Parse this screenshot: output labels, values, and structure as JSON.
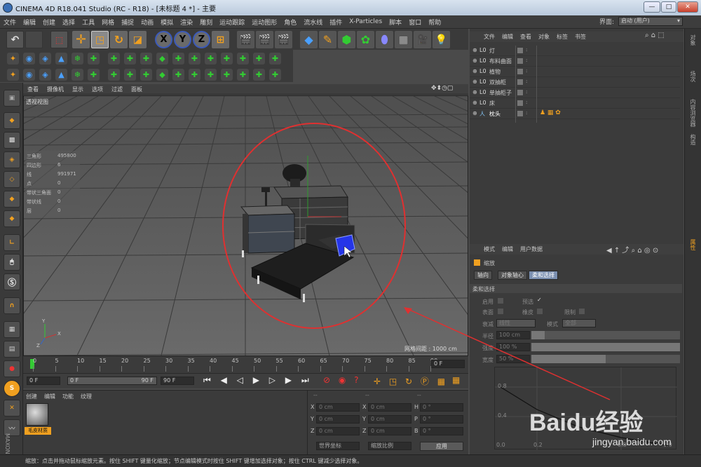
{
  "title": "CINEMA 4D R18.041 Studio (RC - R18) - [未标题 4 *] - 主要",
  "window_controls": {
    "minimize": "—",
    "maximize": "□",
    "close": "✕"
  },
  "menu": [
    "文件",
    "编辑",
    "创建",
    "选择",
    "工具",
    "网格",
    "捕捉",
    "动画",
    "模拟",
    "渲染",
    "雕刻",
    "运动跟踪",
    "运动图形",
    "角色",
    "流水线",
    "插件",
    "X-Particles",
    "脚本",
    "窗口",
    "帮助"
  ],
  "layout": {
    "label": "界面:",
    "value": "启动 (用户)"
  },
  "axis_buttons": {
    "x": "X",
    "y": "Y",
    "z": "Z"
  },
  "viewport": {
    "menu": [
      "查看",
      "摄像机",
      "显示",
      "选项",
      "过滤",
      "面板"
    ],
    "name": "透视视图",
    "grid_spacing": "网格间距 : 1000 cm",
    "stats": [
      {
        "label": "三角形",
        "value": "495800"
      },
      {
        "label": "四边形",
        "value": "6"
      },
      {
        "label": "线",
        "value": "991971"
      },
      {
        "label": "点",
        "value": "0"
      },
      {
        "label": "带状三角面",
        "value": "0"
      },
      {
        "label": "带状线",
        "value": "0"
      },
      {
        "label": "层",
        "value": "0"
      }
    ],
    "axis_labels": {
      "y": "Y",
      "x": "X",
      "z": "Z"
    }
  },
  "timeline": {
    "ticks": [
      "0",
      "5",
      "10",
      "15",
      "20",
      "25",
      "30",
      "35",
      "40",
      "45",
      "50",
      "55",
      "60",
      "65",
      "70",
      "75",
      "80",
      "85",
      "90"
    ],
    "current_frame": "0 F",
    "start": "0 F",
    "range_start": "0 F",
    "range_end": "90 F",
    "end": "90 F"
  },
  "material_panel": {
    "menu": [
      "创建",
      "编辑",
      "功能",
      "纹理"
    ],
    "material_name": "毛皮材质"
  },
  "coords": {
    "dashes": [
      "--",
      "--",
      "--"
    ],
    "rows": [
      {
        "a": "X",
        "av": "0 cm",
        "b": "X",
        "bv": "0 cm",
        "c": "H",
        "cv": "0 °"
      },
      {
        "a": "Y",
        "av": "0 cm",
        "b": "Y",
        "bv": "0 cm",
        "c": "P",
        "cv": "0 °"
      },
      {
        "a": "Z",
        "av": "0 cm",
        "b": "Z",
        "bv": "0 cm",
        "c": "B",
        "cv": "0 °"
      }
    ],
    "mode1": "世界坐标",
    "mode2": "缩放比例",
    "apply": "应用"
  },
  "object_manager": {
    "menu": [
      "文件",
      "编辑",
      "查看",
      "对象",
      "标签",
      "书签"
    ],
    "items": [
      {
        "name": "灯",
        "icon": "L0"
      },
      {
        "name": "布料曲面",
        "icon": "L0"
      },
      {
        "name": "植物",
        "icon": "L0"
      },
      {
        "name": "双抽柜",
        "icon": "L0"
      },
      {
        "name": "单抽柜子",
        "icon": "L0"
      },
      {
        "name": "床",
        "icon": "L0"
      },
      {
        "name": "枕头",
        "icon": "人"
      }
    ]
  },
  "attributes": {
    "menu": [
      "模式",
      "编辑",
      "用户数据"
    ],
    "object_name": "缩放",
    "tabs": [
      "轴向",
      "对象轴心",
      "柔和选择"
    ],
    "section": "柔和选择",
    "enable": "启用",
    "preview": "预选",
    "surface": "表面",
    "rubber": "橡皮",
    "limit": "限制",
    "mode_label": "衰减",
    "mode_value": "线性",
    "mode2_label": "模式",
    "mode2_value": "全部",
    "radius_label": "半径",
    "radius_value": "100 cm",
    "strength_label": "强度",
    "strength_value": "100 %",
    "width_label": "宽度",
    "width_value": "50 %",
    "graph_y": [
      "0.8",
      "0.4"
    ],
    "graph_x": [
      "0.0",
      "0.2",
      "0.8",
      "1.0"
    ]
  },
  "right_strip": [
    "对象",
    "场次",
    "内容浏览器",
    "构造",
    "属性"
  ],
  "status": "缩放：点击并拖动鼠标缩放元素。按住 SHIFT 键量化缩放；节点编辑模式时按住 SHIFT 键增加选择对象；按住 CTRL 键减少选择对象。",
  "watermark": {
    "brand": "Baidu经验",
    "url": "jingyan.baidu.com"
  },
  "colors": {
    "annotation": "#e03030",
    "highlight": "#2b3cff",
    "accent": "#f0a020"
  }
}
